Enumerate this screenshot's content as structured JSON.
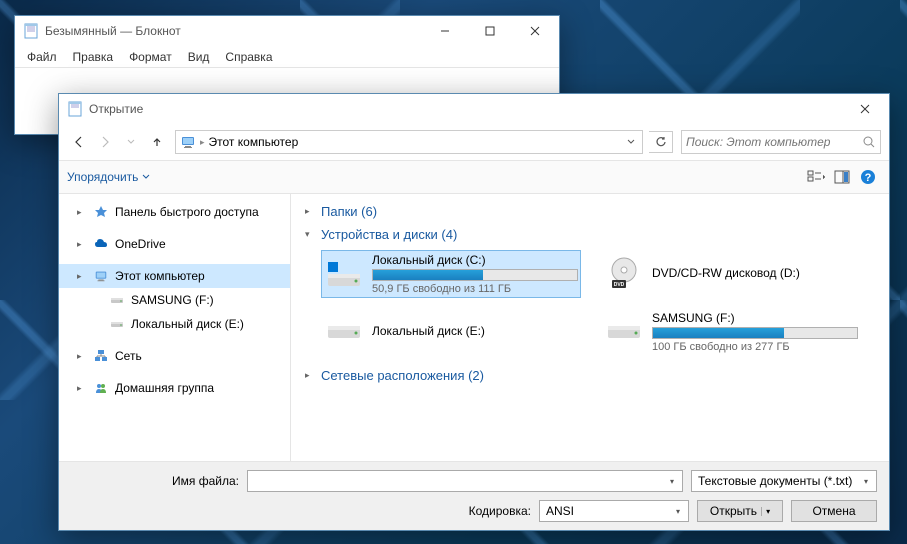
{
  "notepad": {
    "title": "Безымянный — Блокнот",
    "menu": [
      "Файл",
      "Правка",
      "Формат",
      "Вид",
      "Справка"
    ]
  },
  "dialog": {
    "title": "Открытие",
    "address": "Этот компьютер",
    "search_placeholder": "Поиск: Этот компьютер",
    "toolbar_organize": "Упорядочить",
    "sidebar": [
      {
        "label": "Панель быстрого доступа",
        "icon": "star",
        "chevron": "▸"
      },
      {
        "label": "OneDrive",
        "icon": "cloud",
        "chevron": "▸"
      },
      {
        "label": "Этот компьютер",
        "icon": "pc",
        "chevron": "▸",
        "selected": true
      },
      {
        "label": "SAMSUNG (F:)",
        "icon": "drive",
        "chevron": ""
      },
      {
        "label": "Локальный диск (E:)",
        "icon": "drive",
        "chevron": ""
      },
      {
        "label": "Сеть",
        "icon": "network",
        "chevron": "▸"
      },
      {
        "label": "Домашняя группа",
        "icon": "homegroup",
        "chevron": "▸"
      }
    ],
    "sections": {
      "folders": {
        "title": "Папки (6)",
        "expanded": false
      },
      "drives": {
        "title": "Устройства и диски (4)",
        "items": [
          {
            "name": "Локальный диск (C:)",
            "free": "50,9 ГБ свободно из 111 ГБ",
            "fill": 54,
            "icon": "os",
            "selected": true
          },
          {
            "name": "DVD/CD-RW дисковод (D:)",
            "free": "",
            "fill": null,
            "icon": "dvd"
          },
          {
            "name": "Локальный диск (E:)",
            "free": "",
            "fill": null,
            "icon": "hdd"
          },
          {
            "name": "SAMSUNG (F:)",
            "free": "100 ГБ свободно из 277 ГБ",
            "fill": 64,
            "icon": "hdd"
          }
        ]
      },
      "network": {
        "title": "Сетевые расположения (2)",
        "expanded": false
      }
    },
    "footer": {
      "filename_label": "Имя файла:",
      "filename_value": "",
      "filetype": "Текстовые документы (*.txt)",
      "encoding_label": "Кодировка:",
      "encoding_value": "ANSI",
      "open": "Открыть",
      "cancel": "Отмена"
    }
  }
}
